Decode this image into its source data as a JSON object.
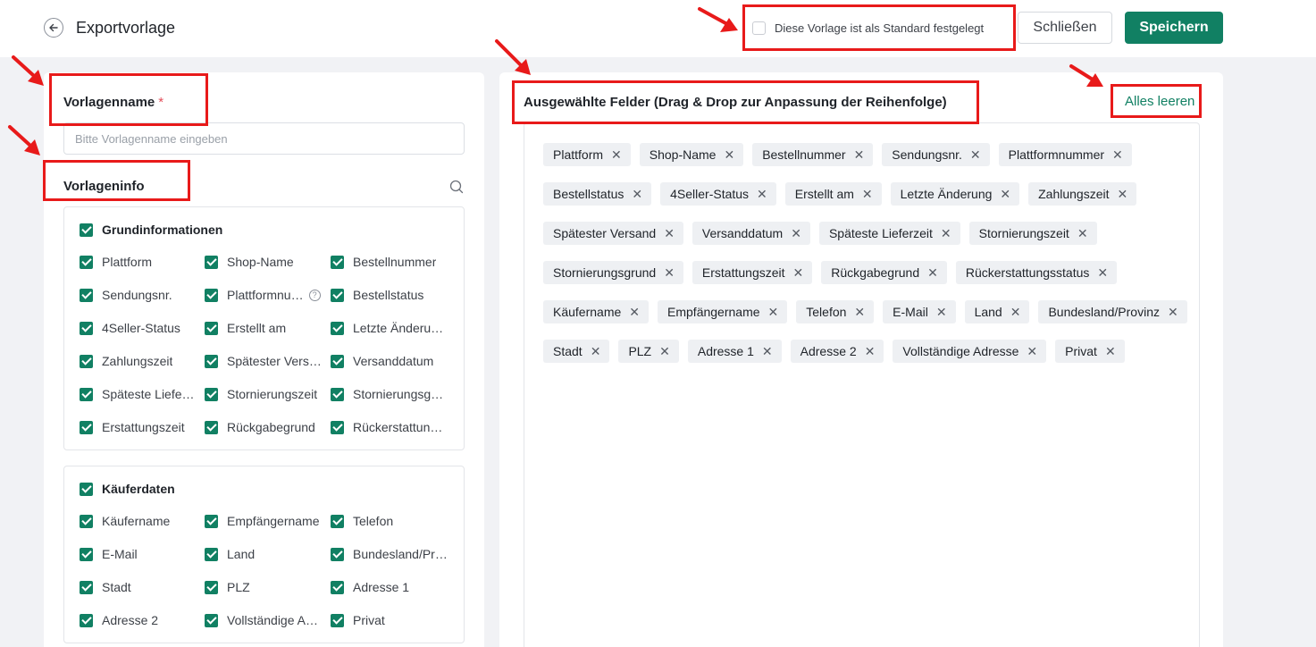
{
  "header": {
    "title": "Exportvorlage",
    "default_label": "Diese Vorlage ist als Standard festgelegt",
    "close_label": "Schließen",
    "save_label": "Speichern"
  },
  "left": {
    "name_label": "Vorlagenname",
    "required_mark": "*",
    "name_placeholder": "Bitte Vorlagenname eingeben",
    "info_label": "Vorlageninfo",
    "groups": [
      {
        "title": "Grundinformationen",
        "items": [
          "Plattform",
          "Shop-Name",
          "Bestellnummer",
          "Sendungsnr.",
          "Plattformnu…",
          "Bestellstatus",
          "4Seller-Status",
          "Erstellt am",
          "Letzte Änderu…",
          "Zahlungszeit",
          "Spätester Vers…",
          "Versanddatum",
          "Späteste Liefe…",
          "Stornierungszeit",
          "Stornierungsg…",
          "Erstattungszeit",
          "Rückgabegrund",
          "Rückerstattun…"
        ]
      },
      {
        "title": "Käuferdaten",
        "items": [
          "Käufername",
          "Empfängername",
          "Telefon",
          "E-Mail",
          "Land",
          "Bundesland/Pr…",
          "Stadt",
          "PLZ",
          "Adresse 1",
          "Adresse 2",
          "Vollständige A…",
          "Privat"
        ]
      }
    ]
  },
  "right": {
    "title": "Ausgewählte Felder (Drag & Drop zur Anpassung der Reihenfolge)",
    "clear_label": "Alles leeren",
    "tags": [
      [
        "Plattform",
        "Shop-Name",
        "Bestellnummer",
        "Sendungsnr.",
        "Plattformnummer"
      ],
      [
        "Bestellstatus",
        "4Seller-Status",
        "Erstellt am",
        "Letzte Änderung",
        "Zahlungszeit"
      ],
      [
        "Spätester Versand",
        "Versanddatum",
        "Späteste Lieferzeit",
        "Stornierungszeit"
      ],
      [
        "Stornierungsgrund",
        "Erstattungszeit",
        "Rückgabegrund",
        "Rückerstattungsstatus"
      ],
      [
        "Käufername",
        "Empfängername",
        "Telefon",
        "E-Mail",
        "Land",
        "Bundesland/Provinz"
      ],
      [
        "Stadt",
        "PLZ",
        "Adresse 1",
        "Adresse 2",
        "Vollständige Adresse",
        "Privat"
      ]
    ]
  },
  "colors": {
    "accent": "#118063",
    "annotation": "#e81a1a"
  }
}
